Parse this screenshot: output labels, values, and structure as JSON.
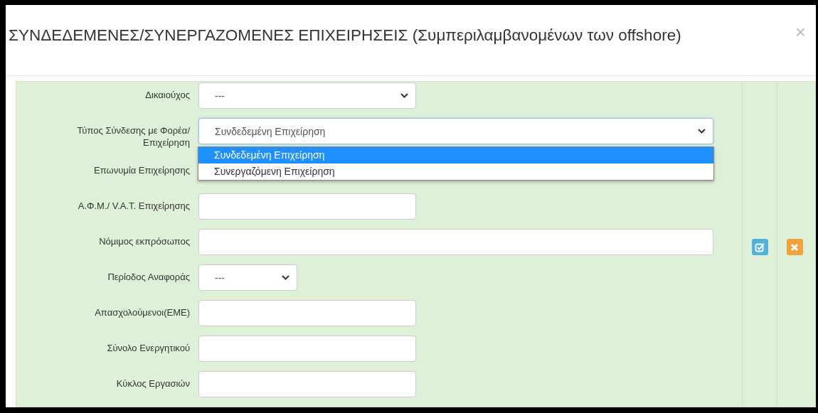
{
  "dialog": {
    "title": "ΣΥΝΔΕΔΕΜΕΝΕΣ/ΣΥΝΕΡΓΑΖΟΜΕΝΕΣ ΕΠΙΧΕΙΡΗΣΕΙΣ (Συμπεριλαμβανομένων των offshore)",
    "close": "×"
  },
  "fields": [
    {
      "label": "Δικαιούχος",
      "kind": "select",
      "value": "---"
    },
    {
      "label": "Τύπος Σύνδεσης με Φορέα/ Επιχείρηση",
      "kind": "select",
      "value": "Συνδεδεμένη Επιχείρηση",
      "open": true,
      "options": [
        {
          "label": "Συνδεδεμένη Επιχείρηση",
          "selected": true
        },
        {
          "label": "Συνεργαζόμενη Επιχείρηση",
          "selected": false
        }
      ]
    },
    {
      "label": "Επωνυμία Επιχείρησης",
      "kind": "covered"
    },
    {
      "label": "Α.Φ.Μ./ V.A.T. Επιχείρησης",
      "kind": "text"
    },
    {
      "label": "Νόμιμος εκπρόσωπος",
      "kind": "text"
    },
    {
      "label": "Περίοδος Αναφοράς",
      "kind": "select",
      "value": "---"
    },
    {
      "label": "Απασχολούμενοι(ΕΜΕ)",
      "kind": "text"
    },
    {
      "label": "Σύνολο Ενεργητικού",
      "kind": "text"
    },
    {
      "label": "Κύκλος Εργασιών",
      "kind": "text"
    }
  ],
  "actions": [
    {
      "kind": "edit"
    },
    {
      "kind": "delete"
    }
  ]
}
